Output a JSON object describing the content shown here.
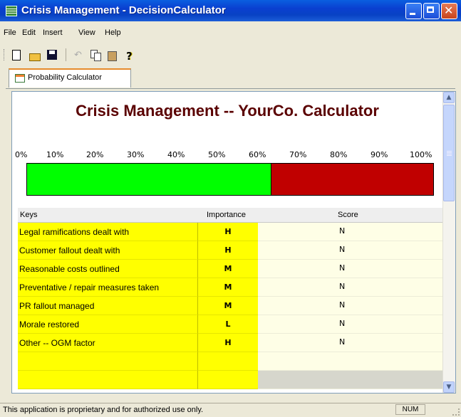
{
  "window": {
    "title": "Crisis Management - DecisionCalculator"
  },
  "menu": [
    "File",
    "Edit",
    "Insert",
    "View",
    "Help"
  ],
  "toolbar": [
    "new-icon",
    "open-icon",
    "save-icon",
    "undo-icon",
    "copy-icon",
    "paste-icon",
    "help-icon"
  ],
  "tab": {
    "label": "Probability Calculator"
  },
  "calculator": {
    "heading": "Crisis Management -- YourCo. Calculator",
    "scale": [
      "0%",
      "10%",
      "20%",
      "30%",
      "40%",
      "50%",
      "60%",
      "70%",
      "80%",
      "90%",
      "100%"
    ],
    "probability_percent": 60,
    "colors": {
      "favorable": "#00ff00",
      "unfavorable": "#c00000"
    }
  },
  "grid": {
    "columns": [
      "Keys",
      "Importance",
      "Score"
    ],
    "rows": [
      {
        "key": "Legal ramifications dealt with",
        "importance": "H",
        "score": "N"
      },
      {
        "key": "Customer fallout dealt with",
        "importance": "H",
        "score": "N"
      },
      {
        "key": "Reasonable costs outlined",
        "importance": "M",
        "score": "N"
      },
      {
        "key": "Preventative / repair measures taken",
        "importance": "M",
        "score": "N"
      },
      {
        "key": "PR fallout managed",
        "importance": "M",
        "score": "N"
      },
      {
        "key": "Morale restored",
        "importance": "L",
        "score": "N"
      },
      {
        "key": "Other -- OGM factor",
        "importance": "H",
        "score": "N"
      },
      {
        "key": "",
        "importance": "",
        "score": ""
      },
      {
        "key": "",
        "importance": "",
        "score": ""
      }
    ]
  },
  "status": {
    "message": "This application is proprietary and for authorized use only.",
    "num": "NUM"
  }
}
